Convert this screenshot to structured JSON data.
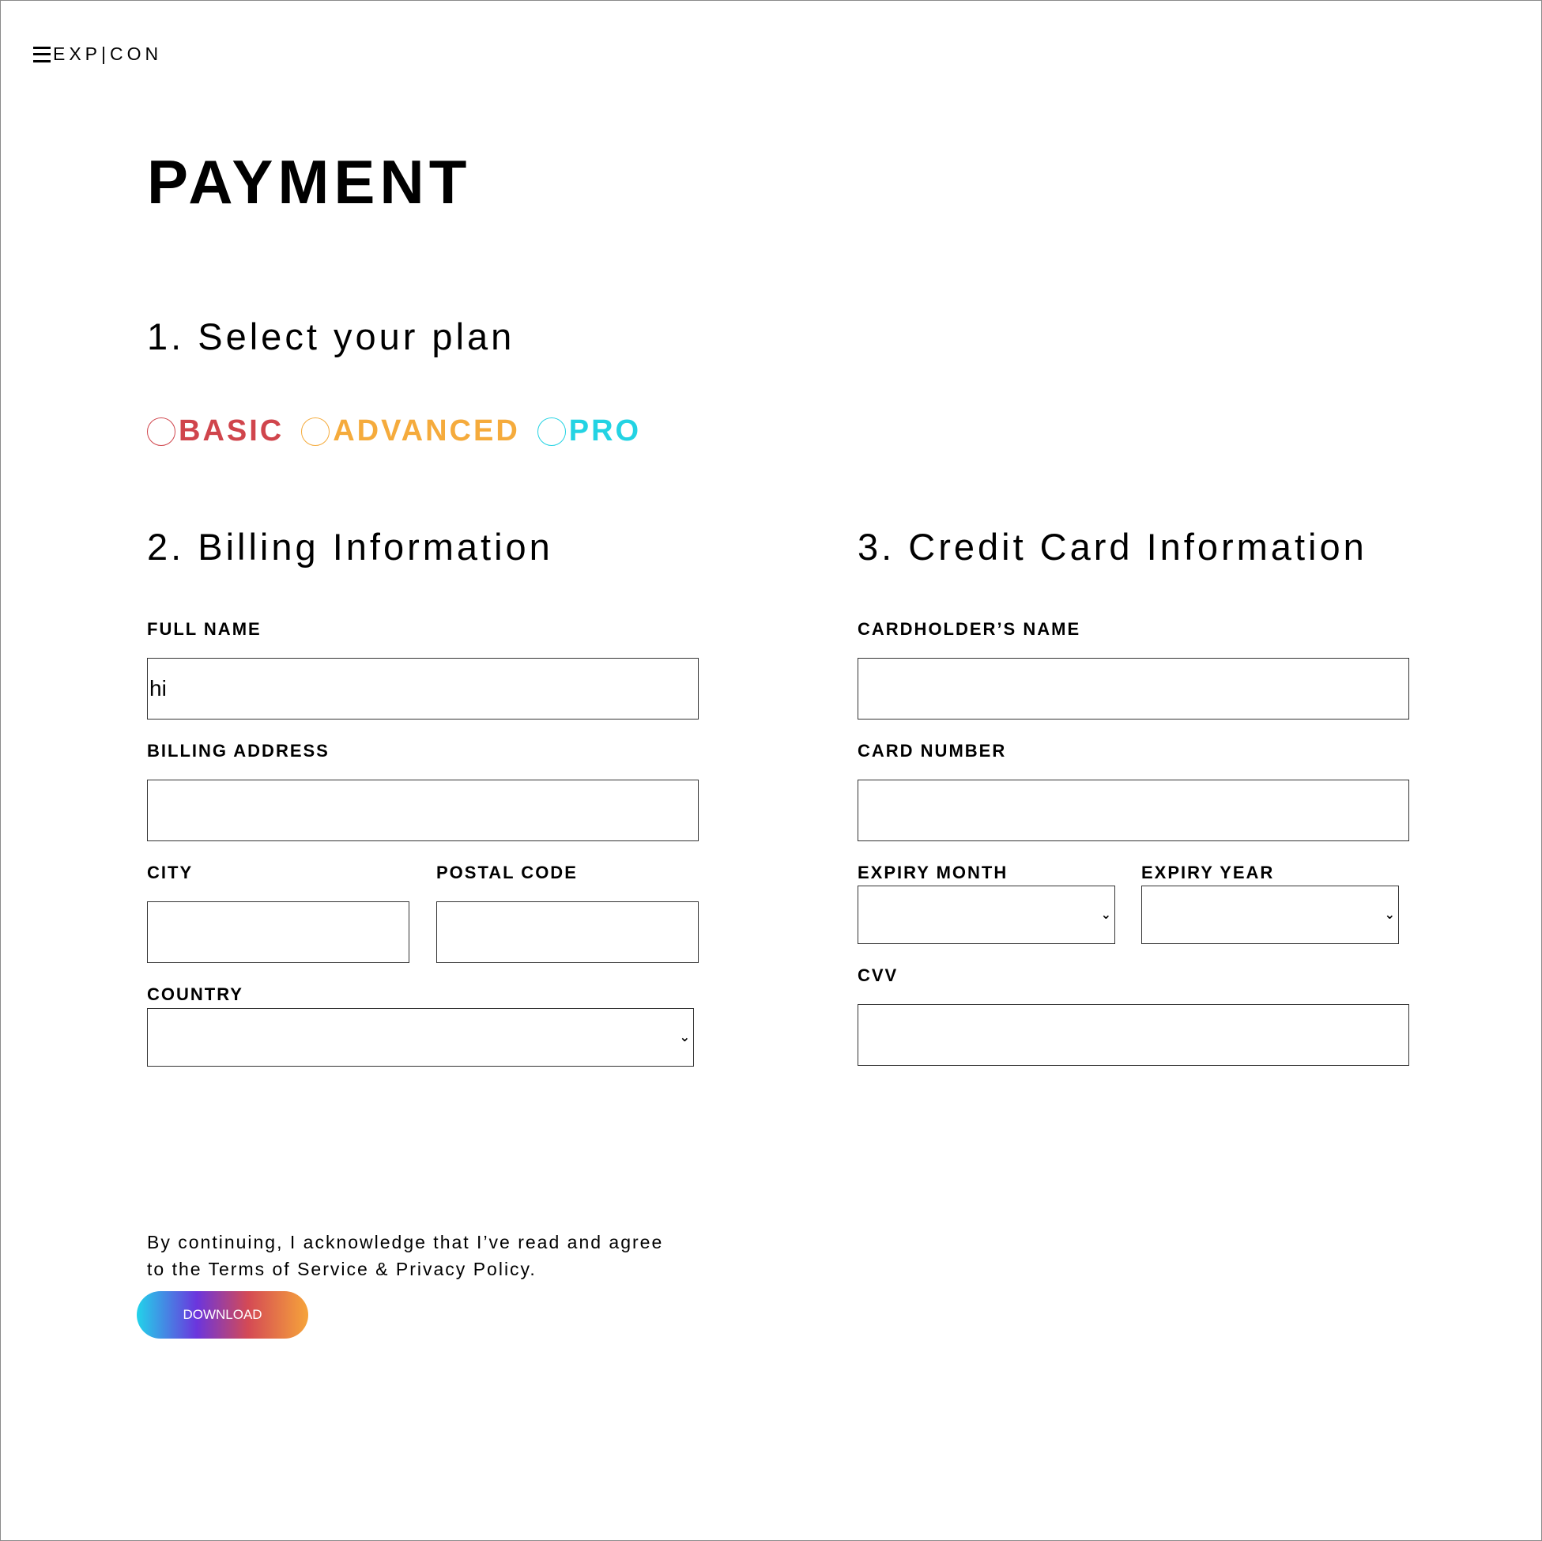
{
  "header": {
    "brand": "EXP|CON"
  },
  "page_title": "PAYMENT",
  "plan_section": {
    "title": "1. Select your plan",
    "plans": [
      {
        "label": "BASIC",
        "color": "#d0454c"
      },
      {
        "label": "ADVANCED",
        "color": "#f5ab3c"
      },
      {
        "label": "PRO",
        "color": "#23d3e3"
      }
    ]
  },
  "billing": {
    "title": "2. Billing Information",
    "full_name_label": "FULL NAME",
    "full_name_value": "hi",
    "address_label": "BILLING ADDRESS",
    "address_value": "",
    "city_label": "CITY",
    "city_value": "",
    "postal_label": "POSTAL CODE",
    "postal_value": "",
    "country_label": "COUNTRY",
    "country_value": ""
  },
  "card": {
    "title": "3. Credit Card Information",
    "holder_label": "CARDHOLDER’S NAME",
    "holder_value": "",
    "number_label": "CARD NUMBER",
    "number_value": "",
    "expiry_month_label": "EXPIRY MONTH",
    "expiry_month_value": "",
    "expiry_year_label": "EXPIRY YEAR",
    "expiry_year_value": "",
    "cvv_label": "CVV",
    "cvv_value": ""
  },
  "footer": {
    "consent_line1": "By continuing, I acknowledge that I’ve read and agree",
    "consent_line2": "to the Terms of Service & Privacy Policy.",
    "download_label": "DOWNLOAD"
  },
  "icons": {
    "menu": "hamburger-icon",
    "dropdown": "chevron-down-icon"
  }
}
